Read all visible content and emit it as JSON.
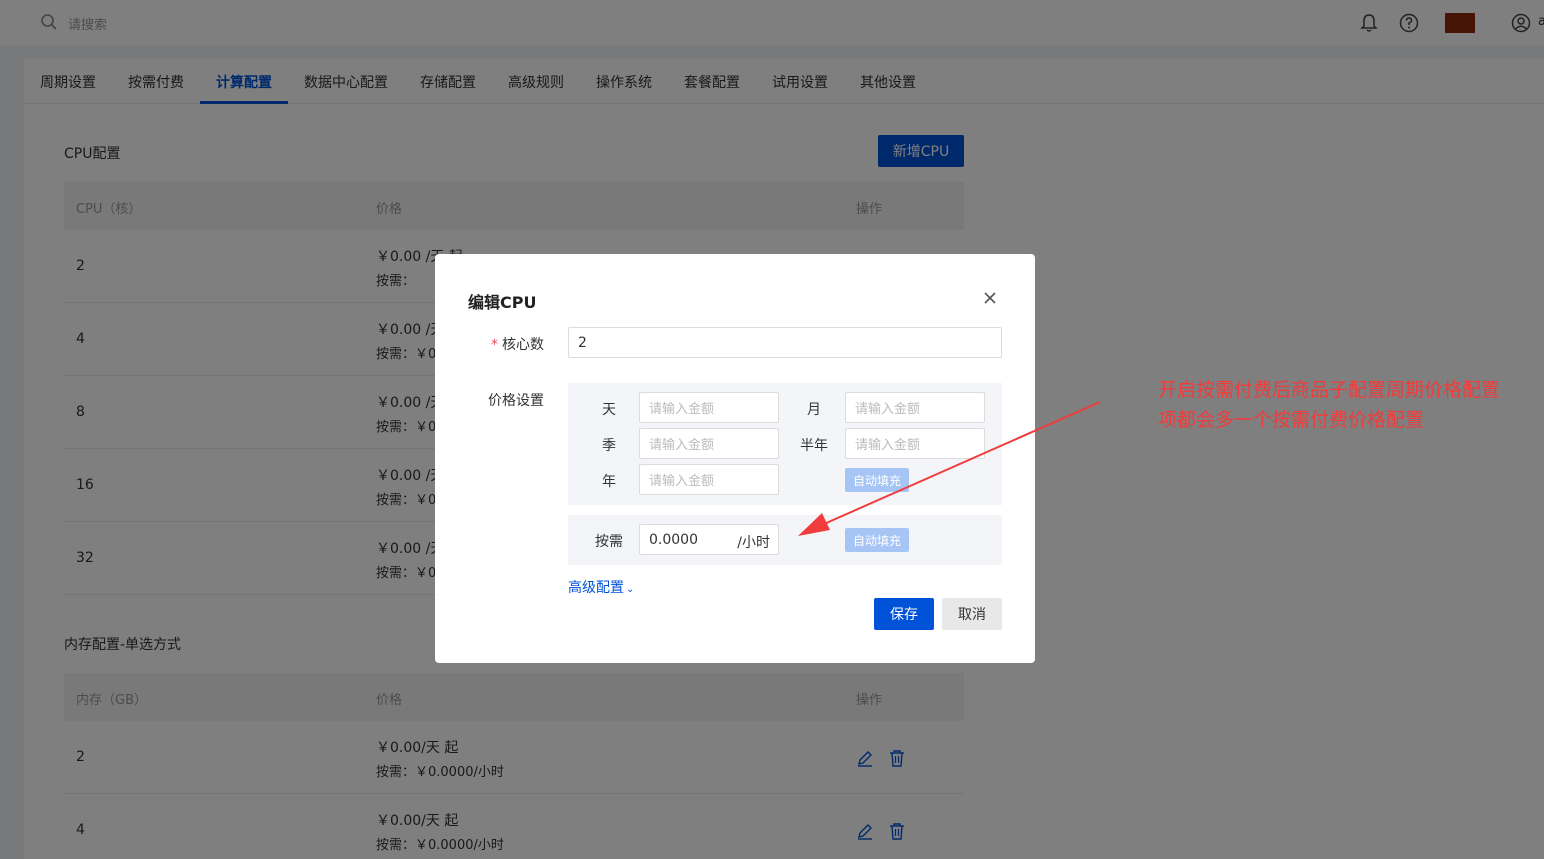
{
  "search": {
    "placeholder": "请搜索"
  },
  "header": {
    "user_initial": "a"
  },
  "tabs": [
    {
      "label": "周期设置"
    },
    {
      "label": "按需付费"
    },
    {
      "label": "计算配置",
      "active": true
    },
    {
      "label": "数据中心配置"
    },
    {
      "label": "存储配置"
    },
    {
      "label": "高级规则"
    },
    {
      "label": "操作系统"
    },
    {
      "label": "套餐配置"
    },
    {
      "label": "试用设置"
    },
    {
      "label": "其他设置"
    }
  ],
  "cpu_section": {
    "title": "CPU配置",
    "add_button": "新增CPU",
    "columns": [
      "CPU（核）",
      "价格",
      "操作"
    ],
    "rows": [
      {
        "value": "2",
        "price_line1": "￥0.00 /天  起",
        "price_line2": "按需："
      },
      {
        "value": "4",
        "price_line1": "￥0.00 /天",
        "price_line2": "按需：￥0"
      },
      {
        "value": "8",
        "price_line1": "￥0.00 /天",
        "price_line2": "按需：￥0"
      },
      {
        "value": "16",
        "price_line1": "￥0.00 /天",
        "price_line2": "按需：￥0"
      },
      {
        "value": "32",
        "price_line1": "￥0.00 /天",
        "price_line2": "按需：￥0"
      }
    ]
  },
  "memory_section": {
    "title": "内存配置-单选方式",
    "columns": [
      "内存（GB）",
      "价格",
      "操作"
    ],
    "rows": [
      {
        "value": "2",
        "price_line1": "￥0.00/天  起",
        "price_line2": "按需：￥0.0000/小时"
      },
      {
        "value": "4",
        "price_line1": "￥0.00/天  起",
        "price_line2": "按需：￥0.0000/小时"
      }
    ]
  },
  "modal": {
    "title": "编辑CPU",
    "core_label": "核心数",
    "core_value": "2",
    "price_label": "价格设置",
    "periods": {
      "day": "天",
      "month": "月",
      "quarter": "季",
      "half_year": "半年",
      "year": "年"
    },
    "amount_placeholder": "请输入金额",
    "auto_fill": "自动填充",
    "ondemand_label": "按需",
    "ondemand_value": "0.0000",
    "ondemand_unit": "/小时",
    "advanced_link": "高级配置",
    "save_button": "保存",
    "cancel_button": "取消"
  },
  "annotation": {
    "line1": "开启按需付费后商品子配置周期价格配置",
    "line2": "项都会多一个按需付费价格配置",
    "color": "#f03c3c"
  },
  "colors": {
    "primary": "#0052d9",
    "overlay": "rgba(0,0,0,0.5)"
  }
}
